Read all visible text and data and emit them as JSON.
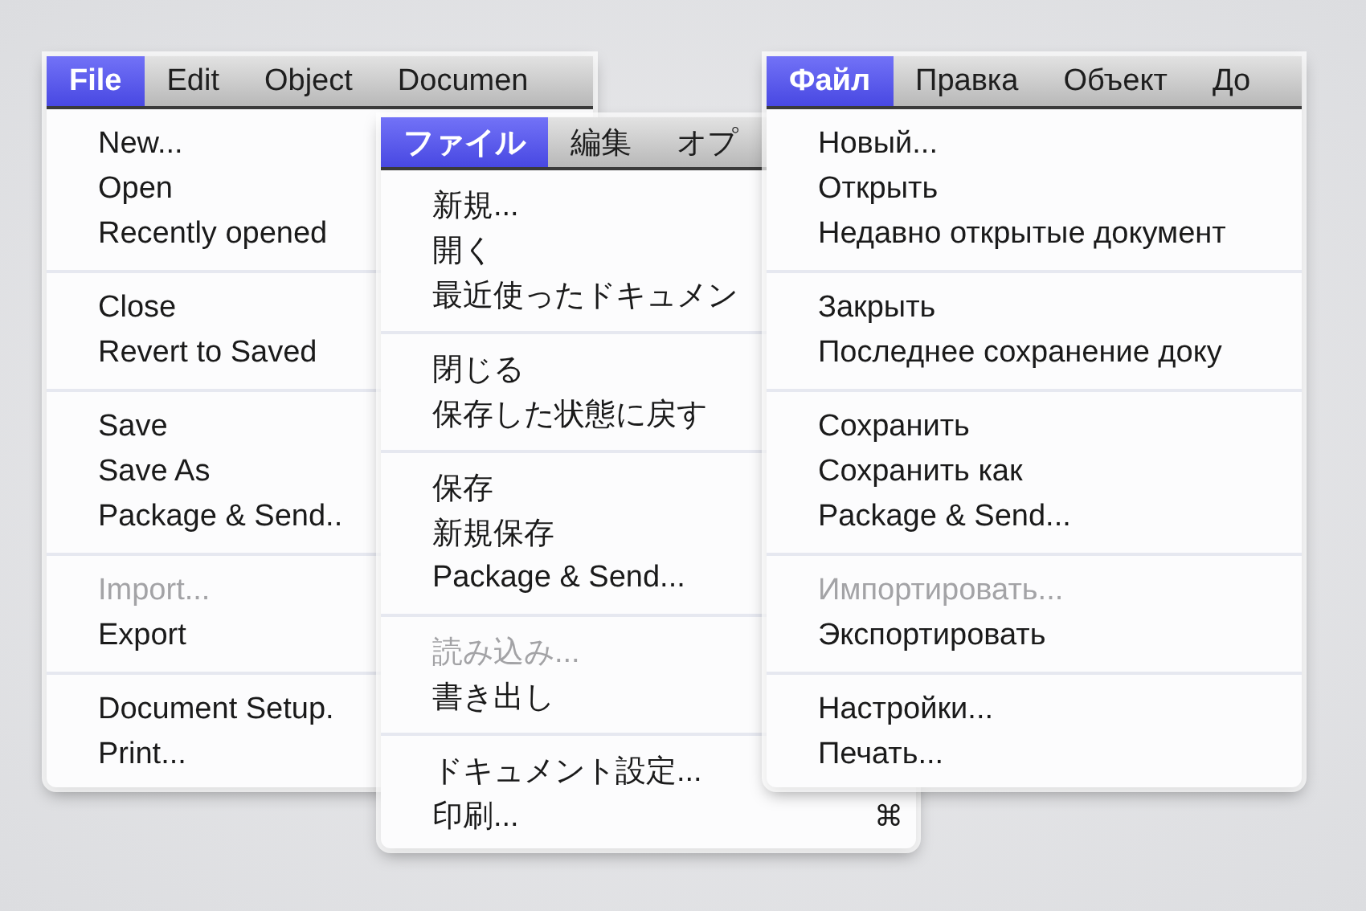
{
  "menus": [
    {
      "menubar": [
        {
          "label": "File",
          "selected": true
        },
        {
          "label": "Edit",
          "selected": false
        },
        {
          "label": "Object",
          "selected": false
        },
        {
          "label": "Documen",
          "selected": false
        }
      ],
      "groups": [
        [
          {
            "label": "New...",
            "disabled": false
          },
          {
            "label": "Open",
            "disabled": false
          },
          {
            "label": "Recently opened",
            "disabled": false
          }
        ],
        [
          {
            "label": "Close",
            "disabled": false
          },
          {
            "label": "Revert to Saved",
            "disabled": false
          }
        ],
        [
          {
            "label": "Save",
            "disabled": false
          },
          {
            "label": "Save As",
            "disabled": false
          },
          {
            "label": "Package & Send..",
            "disabled": false
          }
        ],
        [
          {
            "label": "Import...",
            "disabled": true
          },
          {
            "label": "Export",
            "disabled": false
          }
        ],
        [
          {
            "label": "Document Setup.",
            "disabled": false
          },
          {
            "label": "Print...",
            "disabled": false
          }
        ]
      ]
    },
    {
      "menubar": [
        {
          "label": "ファイル",
          "selected": true
        },
        {
          "label": "編集",
          "selected": false
        },
        {
          "label": "オプ",
          "selected": false
        }
      ],
      "groups": [
        [
          {
            "label": "新規...",
            "disabled": false
          },
          {
            "label": "開く",
            "disabled": false
          },
          {
            "label": "最近使ったドキュメン",
            "disabled": false
          }
        ],
        [
          {
            "label": "閉じる",
            "disabled": false
          },
          {
            "label": "保存した状態に戻す",
            "disabled": false
          }
        ],
        [
          {
            "label": "保存",
            "disabled": false
          },
          {
            "label": "新規保存",
            "disabled": false
          },
          {
            "label": "Package & Send...",
            "disabled": false
          }
        ],
        [
          {
            "label": "読み込み...",
            "disabled": true
          },
          {
            "label": "書き出し",
            "disabled": false
          }
        ],
        [
          {
            "label": "ドキュメント設定...",
            "disabled": false
          },
          {
            "label": "印刷...",
            "disabled": false,
            "shortcut": "⌘"
          }
        ]
      ]
    },
    {
      "menubar": [
        {
          "label": "Файл",
          "selected": true
        },
        {
          "label": "Правка",
          "selected": false
        },
        {
          "label": "Объект",
          "selected": false
        },
        {
          "label": "До",
          "selected": false
        }
      ],
      "groups": [
        [
          {
            "label": "Новый...",
            "disabled": false
          },
          {
            "label": "Открыть",
            "disabled": false
          },
          {
            "label": "Недавно открытые документ",
            "disabled": false
          }
        ],
        [
          {
            "label": "Закрыть",
            "disabled": false
          },
          {
            "label": "Последнее сохранение доку",
            "disabled": false
          }
        ],
        [
          {
            "label": "Сохранить",
            "disabled": false
          },
          {
            "label": "Сохранить как",
            "disabled": false
          },
          {
            "label": "Package & Send...",
            "disabled": false
          }
        ],
        [
          {
            "label": "Импортировать...",
            "disabled": true
          },
          {
            "label": "Экспортировать",
            "disabled": false
          }
        ],
        [
          {
            "label": "Настройки...",
            "disabled": false
          },
          {
            "label": "Печать...",
            "disabled": false
          }
        ]
      ]
    }
  ]
}
